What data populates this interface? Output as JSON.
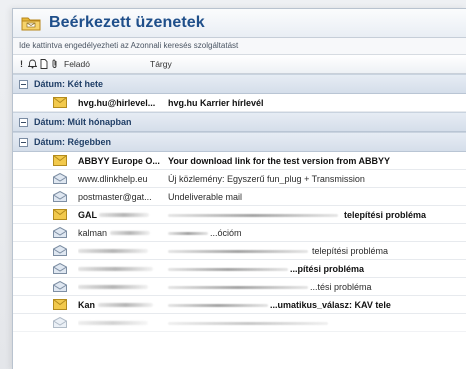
{
  "window": {
    "title": "Beérkezett üzenetek",
    "info_bar": "Ide kattintva engedélyezheti az Azonnali keresés szolgáltatást"
  },
  "columns": {
    "importance_icon": "!",
    "reminder_icon": "bell-icon",
    "type_icon": "page-icon",
    "attachment_icon": "paperclip-icon",
    "from": "Feladó",
    "subject": "Tárgy"
  },
  "groups": [
    {
      "label": "Dátum: Két hete",
      "messages": [
        {
          "from": "hvg.hu@hirlevel...",
          "subject": "hvg.hu Karrier hírlevél",
          "unread": true,
          "icon": "closed-envelope-icon"
        }
      ]
    },
    {
      "label": "Dátum: Múlt hónapban",
      "messages": []
    },
    {
      "label": "Dátum: Régebben",
      "messages": [
        {
          "from": "ABBYY Europe O...",
          "subject": "Your download link for the test version from ABBYY",
          "unread": true,
          "icon": "closed-envelope-icon"
        },
        {
          "from": "www.dlinkhelp.eu",
          "subject": "Új közlemény: Egyszerű fun_plug + Transmission",
          "unread": false,
          "icon": "open-envelope-icon"
        },
        {
          "from": "postmaster@gat...",
          "subject": "Undeliverable mail",
          "unread": false,
          "icon": "open-envelope-icon"
        },
        {
          "from": "GAL",
          "subject": "telepítési probléma",
          "unread": true,
          "icon": "closed-envelope-icon",
          "from_redacted": true,
          "subject_prefix_redacted": true
        },
        {
          "from": "kalman",
          "subject": "...ócióm",
          "unread": false,
          "icon": "open-envelope-icon",
          "from_redacted": true,
          "subject_prefix_redacted": true
        },
        {
          "from": "",
          "subject": "telepítési probléma",
          "unread": false,
          "icon": "open-envelope-icon",
          "from_redacted": true,
          "subject_prefix_redacted": true
        },
        {
          "from": "",
          "subject": "...pítési probléma",
          "unread": true,
          "icon": "open-envelope-icon",
          "from_redacted": true,
          "subject_prefix_redacted": true
        },
        {
          "from": "",
          "subject": "...tési probléma",
          "unread": false,
          "icon": "open-envelope-icon",
          "from_redacted": true,
          "subject_prefix_redacted": true
        },
        {
          "from": "Kan",
          "subject": "...umatikus_válasz: KAV tele",
          "unread": true,
          "icon": "closed-envelope-icon",
          "from_redacted": true,
          "subject_prefix_redacted": true
        }
      ]
    }
  ],
  "colors": {
    "title": "#1f4f8a",
    "group_text": "#1f3e66",
    "envelope_closed": "#f2c94c",
    "envelope_open": "#cfd9e6"
  }
}
